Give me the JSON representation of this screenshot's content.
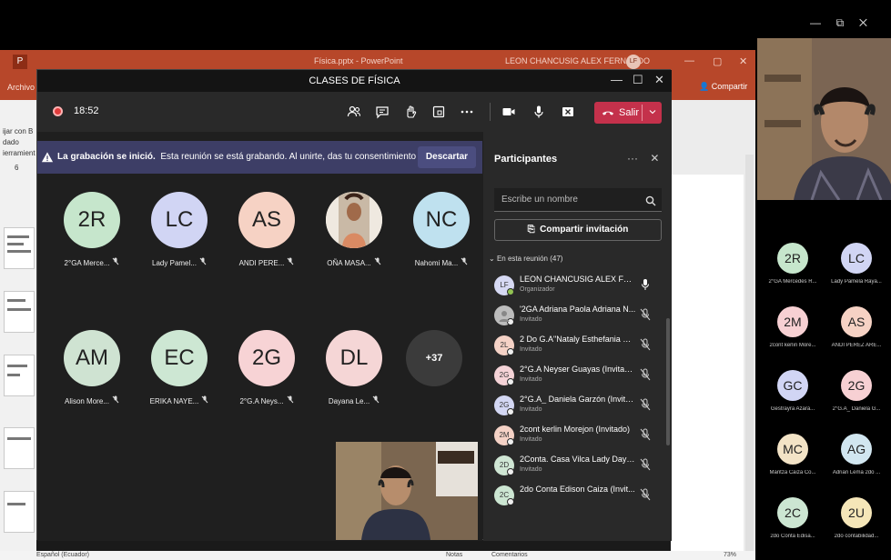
{
  "powerpoint": {
    "logo": "P",
    "title": "Física.pptx - PowerPoint",
    "user": "LEON CHANCUSIG ALEX FERNANDO",
    "user_initials": "LF",
    "ribbon_tab": "Archivo",
    "share_label": "Compartir",
    "left_snippets": [
      "ijar con B",
      "dado",
      "ierramient",
      "6"
    ],
    "status": {
      "language": "Español (Ecuador)",
      "notes": "Notas",
      "comments": "Comentarios",
      "zoom": "73%"
    }
  },
  "teams": {
    "window_title": "CLASES DE FÍSICA",
    "timer": "18:52",
    "leave_label": "Salir",
    "banner": {
      "title": "La grabación se inició.",
      "message": "Esta reunión se está grabando. Al unirte, das tu consentimiento para ...",
      "dismiss_label": "Descartar"
    },
    "gallery": [
      {
        "initials": "2R",
        "name": "2°GA Merce...",
        "color": "#c6e6cc"
      },
      {
        "initials": "LC",
        "name": "Lady Pamel...",
        "color": "#d1d5f4"
      },
      {
        "initials": "AS",
        "name": "ANDI PERE...",
        "color": "#f6d2c4"
      },
      {
        "initials": "",
        "name": "OÑA MASA...",
        "color": "#f3efe9",
        "photo": true
      },
      {
        "initials": "NC",
        "name": "Nahomi Ma...",
        "color": "#bfe1ef"
      },
      {
        "initials": "AM",
        "name": "Alison More...",
        "color": "#cfe3d2"
      },
      {
        "initials": "EC",
        "name": "ERIKA NAYE...",
        "color": "#cde7d3"
      },
      {
        "initials": "2G",
        "name": "2°G.A Neys...",
        "color": "#f7d3d5"
      },
      {
        "initials": "DL",
        "name": "Dayana Le...",
        "color": "#f5d6d6"
      }
    ],
    "more_count": "+37"
  },
  "participants": {
    "title": "Participantes",
    "search_placeholder": "Escribe un nombre",
    "invite_label": "Compartir invitación",
    "section": "En esta reunión (47)",
    "list": [
      {
        "initials": "LF",
        "name": "LEON CHANCUSIG ALEX FER...",
        "role": "Organizador",
        "color": "#d6d9f3"
      },
      {
        "initials": "",
        "name": "'2GA Adriana Paola Adriana N...",
        "role": "Invitado",
        "color": "#bdbdbd"
      },
      {
        "initials": "2L",
        "name": "2 Do G.A\"Nataly Esthefania M...",
        "role": "Invitado",
        "color": "#f5d2c6"
      },
      {
        "initials": "2G",
        "name": "2°G.A Neyser Guayas (Invitado)",
        "role": "Invitado",
        "color": "#f5d3d7"
      },
      {
        "initials": "2G",
        "name": "2°G.A_ Daniela Garzón (Invita...",
        "role": "Invitado",
        "color": "#d3d7f3"
      },
      {
        "initials": "2M",
        "name": "2cont kerlin Morejon (Invitado)",
        "role": "Invitado",
        "color": "#f5d2c6"
      },
      {
        "initials": "2D",
        "name": "2Conta. Casa Vilca Lady Daya...",
        "role": "Invitado",
        "color": "#cfe6d4"
      },
      {
        "initials": "2C",
        "name": "2do Conta Edison Caiza (Invit...",
        "role": "",
        "color": "#cce6d2"
      }
    ]
  },
  "side_strip": [
    {
      "initials": "2R",
      "name": "2°GA Mercedes R...",
      "color": "#c6e6cc"
    },
    {
      "initials": "LC",
      "name": "Lady Pamela Raya...",
      "color": "#d1d5f4"
    },
    {
      "initials": "2M",
      "name": "2cont kerlin More...",
      "color": "#f7d0d3"
    },
    {
      "initials": "AS",
      "name": "ANDI PEREZ ARE...",
      "color": "#f6d2c4"
    },
    {
      "initials": "GC",
      "name": "Gestrayra Azará...",
      "color": "#d1d5f4"
    },
    {
      "initials": "2G",
      "name": "2°G.A_ Daniela G...",
      "color": "#f7d0d3"
    },
    {
      "initials": "MC",
      "name": "Maritza Caiza Co...",
      "color": "#f3e3c6"
    },
    {
      "initials": "AG",
      "name": "Adrian Lema 2do ...",
      "color": "#d1e6f0"
    },
    {
      "initials": "2C",
      "name": "2do Conta Edisa...",
      "color": "#cce6d2"
    },
    {
      "initials": "2U",
      "name": "2do contabilidad...",
      "color": "#f5e6b8"
    }
  ]
}
